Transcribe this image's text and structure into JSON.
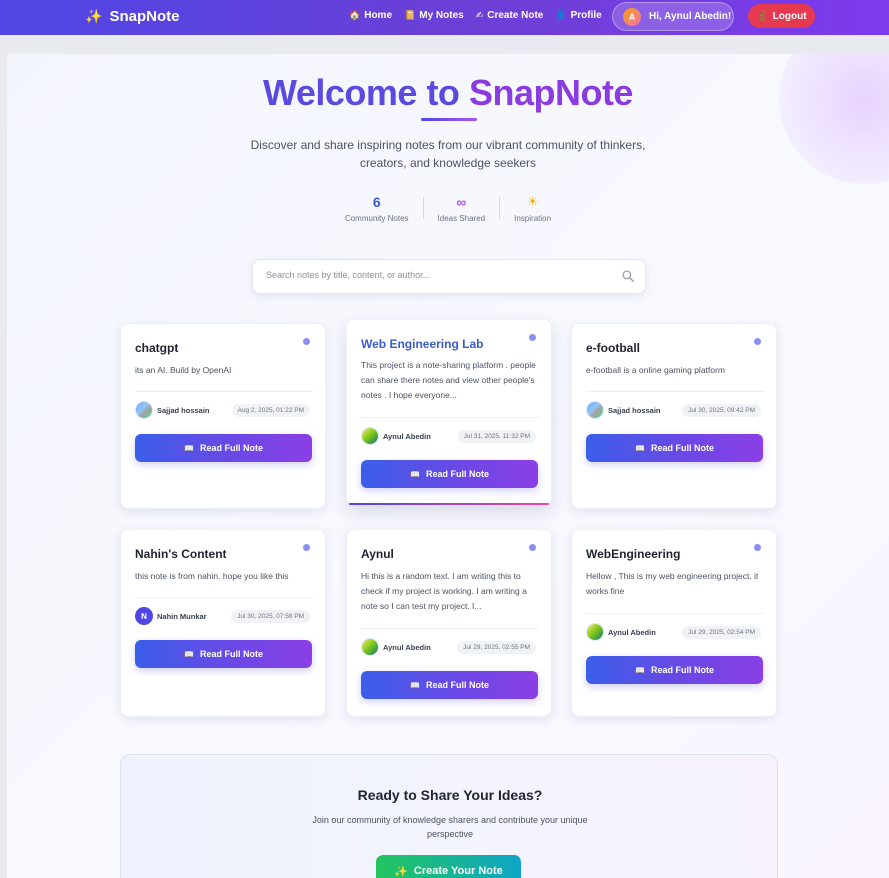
{
  "nav": {
    "brand": "SnapNote",
    "brand_icon": "sparkles-icon",
    "links": [
      {
        "label": "Home",
        "icon": "house-icon"
      },
      {
        "label": "My Notes",
        "icon": "notebook-icon"
      },
      {
        "label": "Create Note",
        "icon": "writing-hand-icon"
      },
      {
        "label": "Profile",
        "icon": "person-icon"
      }
    ],
    "user_initial": "A",
    "user_greeting": "Hi, Aynul Abedin!",
    "logout_label": "Logout"
  },
  "hero": {
    "title_part1": "Welcome to",
    "title_part2": "SnapNote",
    "subtitle": "Discover and share inspiring notes from our vibrant community of thinkers, creators, and knowledge seekers"
  },
  "stats": [
    {
      "value": "6",
      "label": "Community Notes"
    },
    {
      "value": "∞",
      "label": "Ideas Shared"
    },
    {
      "value": "☀",
      "label": "Inspiration"
    }
  ],
  "search": {
    "placeholder": "Search notes by title, content, or author..."
  },
  "notes": [
    {
      "title": "chatgpt",
      "description": "its an AI. Build by OpenAI",
      "author": "Sajjad hossain",
      "avatar": "photo",
      "date": "Aug 2, 2025, 01:22 PM",
      "button": "Read Full Note"
    },
    {
      "title": "Web Engineering Lab",
      "description": "This project is a note-sharing platform . people can share there notes and view other people's notes . I hope everyone...",
      "author": "Aynul Abedin",
      "avatar": "photo",
      "date": "Jul 31, 2025, 11:32 PM",
      "button": "Read Full Note"
    },
    {
      "title": "e-football",
      "description": "e-football is a online gaming platform",
      "author": "Sajjad hossain",
      "avatar": "photo",
      "date": "Jul 30, 2025, 09:42 PM",
      "button": "Read Full Note"
    },
    {
      "title": "Nahin's Content",
      "description": "this note is from nahin. hope you like this",
      "author": "Nahin Munkar",
      "avatar": "N",
      "date": "Jul 30, 2025, 07:58 PM",
      "button": "Read Full Note"
    },
    {
      "title": "Aynul",
      "description": "Hi this is a random text. I am writing this to check if my project is working. I am writing a note so I can test my project. I...",
      "author": "Aynul Abedin",
      "avatar": "photo",
      "date": "Jul 29, 2025, 02:55 PM",
      "button": "Read Full Note"
    },
    {
      "title": "WebEngineering",
      "description": "Hellow , This is my web engineering project. it works fine",
      "author": "Aynul Abedin",
      "avatar": "photo",
      "date": "Jul 29, 2025, 02:54 PM",
      "button": "Read Full Note"
    }
  ],
  "cta": {
    "title": "Ready to Share Your Ideas?",
    "subtitle": "Join our community of knowledge sharers and contribute your unique perspective",
    "button": "Create Your Note"
  },
  "colors": {
    "nav_gradient_start": "#4f46e5",
    "nav_gradient_end": "#7c3aed",
    "logout": "#e53950",
    "button_gradient_start": "#3b5ee8",
    "button_gradient_end": "#8b3fe6",
    "cta_button_start": "#22c55e",
    "cta_button_end": "#0ea5c6"
  }
}
